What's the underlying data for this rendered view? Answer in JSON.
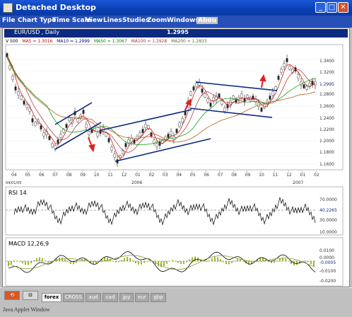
{
  "window": {
    "title": "Detached Desktop",
    "min_label": "_",
    "max_label": "□",
    "close_label": "✕"
  },
  "menu": [
    "File",
    "Chart Type",
    "Time Scale",
    "View",
    "Lines",
    "Studies",
    "Zoom",
    "Windows",
    "Abou"
  ],
  "chart": {
    "symbol": "EUR/USD , Daily",
    "price": "1.2995",
    "legend": [
      {
        "text": "V 500",
        "color": "#000000"
      },
      {
        "text": "MA5 = 1.3016",
        "color": "#cc0000"
      },
      {
        "text": "MA10 = 1.2999",
        "color": "#000080"
      },
      {
        "text": "MA50 = 1.3067",
        "color": "#008000"
      },
      {
        "text": "MA100 = 1.2928",
        "color": "#aa3333"
      },
      {
        "text": "MA200 = 1.2833",
        "color": "#556b2f"
      }
    ],
    "y_ticks": [
      "1.3400",
      "1.3200",
      "1.2995",
      "1.2800",
      "1.2600",
      "1.2400",
      "1.2200",
      "1.2000",
      "1.1800",
      "1.1600"
    ],
    "x_ticks": [
      "04",
      "05",
      "06",
      "07",
      "08",
      "09",
      "10",
      "11",
      "12",
      "01",
      "02",
      "03",
      "04",
      "05",
      "06",
      "07",
      "08",
      "09",
      "10",
      "11",
      "12",
      "01",
      "02"
    ],
    "x_start_label": "04/01/05",
    "year_labels": [
      "2006",
      "2007"
    ],
    "rsi": {
      "title": "RSI 14",
      "ticks": [
        "70.0000",
        "40.2265",
        "30.0000",
        "10.0000"
      ]
    },
    "macd": {
      "title": "MACD 12,26,9",
      "ticks": [
        "0.0100",
        "0.0000",
        "-0.0005",
        "-0.0100",
        "-0.0200"
      ]
    }
  },
  "taskbar": {
    "buttons": [
      "⟲",
      "⊟"
    ],
    "tabs": [
      "forex",
      "CROSS",
      "aud",
      "cad",
      "jpy",
      "eur",
      "gbp"
    ]
  },
  "statusbar": {
    "text": "Java Applet Window"
  }
}
